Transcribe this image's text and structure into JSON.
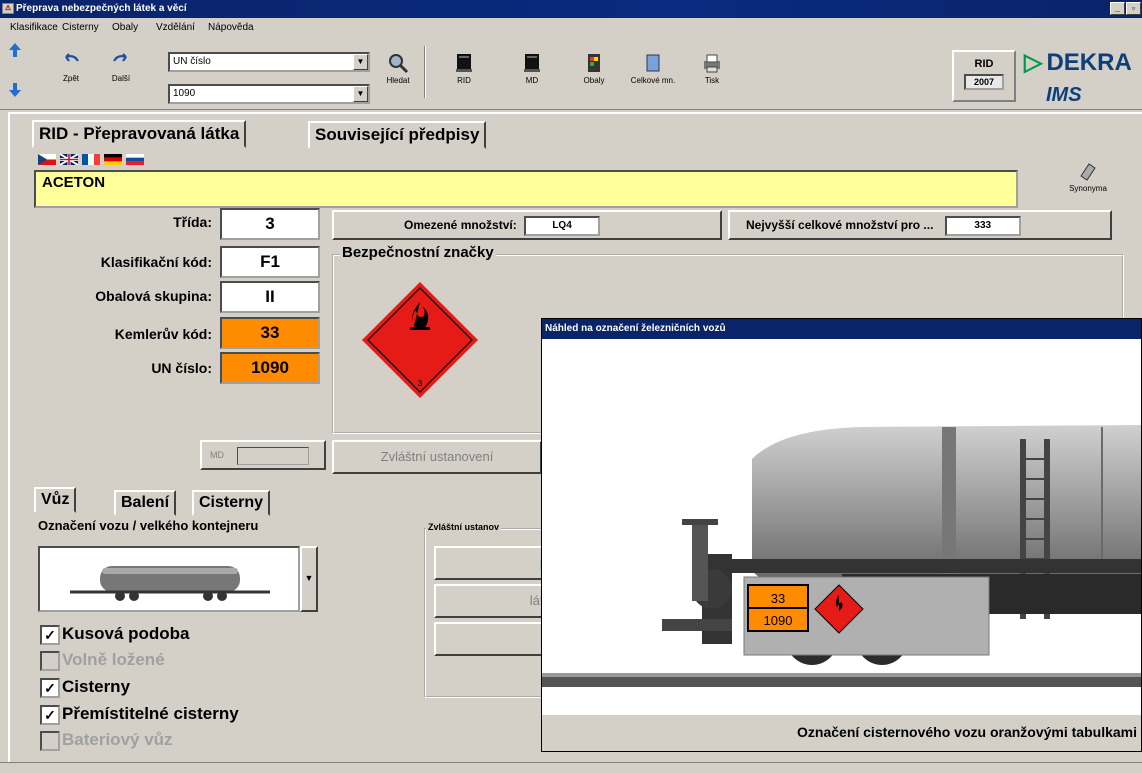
{
  "window": {
    "title": "Přeprava nebezpečných látek a věcí"
  },
  "menu": [
    "Klasifikace",
    "Cisterny",
    "Obaly",
    "Vzdělání",
    "Nápověda"
  ],
  "toolbar": {
    "back_label": "Zpět",
    "forward_label": "Další",
    "search_type": "UN číslo",
    "search_value": "1090",
    "buttons": [
      "Hledat",
      "RID",
      "MD",
      "Obaly",
      "Celkové mn.",
      "Tisk"
    ],
    "rid_label": "RID",
    "rid_year": "2007",
    "brand": "DEKRA",
    "brand2": "IMS"
  },
  "tabs_top": [
    "RID - Přepravovaná látka",
    "Související předpisy"
  ],
  "substance_name": "ACETON",
  "synonyms_label": "Synonyma",
  "fields": {
    "trida_label": "Třída:",
    "trida": "3",
    "klas_label": "Klasifikační kód:",
    "klas": "F1",
    "obal_label": "Obalová skupina:",
    "obal": "II",
    "kemler_label": "Kemlerův kód:",
    "kemler": "33",
    "un_label": "UN číslo:",
    "un": "1090"
  },
  "limited_qty": {
    "label": "Omezené množství:",
    "value": "LQ4"
  },
  "max_total": {
    "label": "Nejvyšší celkové množství pro ...",
    "value": "333"
  },
  "safety_signs_title": "Bezpečnostní značky",
  "diamond_number": "3",
  "md_label": "MD",
  "special_provisions_btn": "Zvláštní ustanovení",
  "tabs_bottom": [
    "Vůz",
    "Balení",
    "Cisterny"
  ],
  "vehicle_label": "Označení vozu / velkého kontejneru",
  "special_group_title": "Zvláštní ustanov",
  "special_buttons": [
    "pl",
    "látk",
    ""
  ],
  "checks": [
    {
      "label": "Kusová podoba",
      "checked": true,
      "enabled": true
    },
    {
      "label": "Volně ložené",
      "checked": false,
      "enabled": false
    },
    {
      "label": "Cisterny",
      "checked": true,
      "enabled": true
    },
    {
      "label": "Přemístitelné cisterny",
      "checked": true,
      "enabled": true
    },
    {
      "label": "Bateriový vůz",
      "checked": false,
      "enabled": false
    }
  ],
  "preview": {
    "title": "Náhled na označení železničních vozů",
    "plate_top": "33",
    "plate_bottom": "1090",
    "caption": "Označení cisternového vozu oranžovými tabulkami"
  }
}
